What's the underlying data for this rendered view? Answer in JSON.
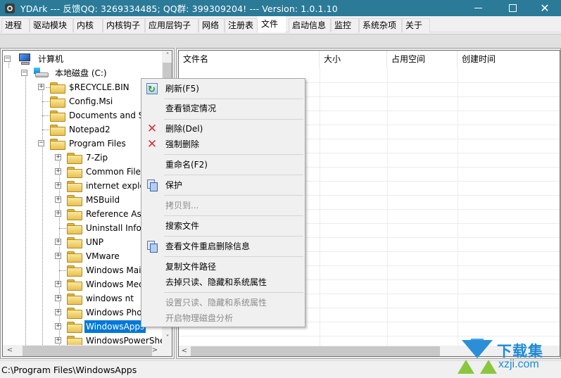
{
  "window": {
    "title": "YDArk --- 反馈QQ: 3269334485; QQ群: 399309204! --- Version: 1.0.1.10",
    "minimize_icon": "minimize-icon",
    "maximize_icon": "maximize-icon",
    "close_glyph": "✕"
  },
  "tabs": [
    {
      "label": "进程",
      "active": false
    },
    {
      "label": "驱动模块",
      "active": false
    },
    {
      "label": "内核",
      "active": false
    },
    {
      "label": "内核钩子",
      "active": false
    },
    {
      "label": "应用层钩子",
      "active": false
    },
    {
      "label": "网络",
      "active": false
    },
    {
      "label": "注册表",
      "active": false
    },
    {
      "label": "文件",
      "active": true
    },
    {
      "label": "启动信息",
      "active": false
    },
    {
      "label": "监控",
      "active": false
    },
    {
      "label": "系统杂项",
      "active": false
    },
    {
      "label": "关于",
      "active": false
    }
  ],
  "tree": {
    "root": {
      "label": "计算机",
      "expander": "−",
      "icon": "computer-icon"
    },
    "drive": {
      "label": "本地磁盘 (C:)",
      "expander": "−",
      "icon": "drive-icon"
    },
    "level1": [
      {
        "label": "$RECYCLE.BIN",
        "expander": "+"
      },
      {
        "label": "Config.Msi",
        "expander": ""
      },
      {
        "label": "Documents and Settings",
        "expander": ""
      },
      {
        "label": "Notepad2",
        "expander": ""
      },
      {
        "label": "Program Files",
        "expander": "−"
      }
    ],
    "level2": [
      {
        "label": "7-Zip",
        "expander": "+"
      },
      {
        "label": "Common Files",
        "expander": "+"
      },
      {
        "label": "internet explorer",
        "expander": "+"
      },
      {
        "label": "MSBuild",
        "expander": "+"
      },
      {
        "label": "Reference Assemblies",
        "expander": "+"
      },
      {
        "label": "Uninstall Information",
        "expander": ""
      },
      {
        "label": "UNP",
        "expander": "+"
      },
      {
        "label": "VMware",
        "expander": "+"
      },
      {
        "label": "Windows Mail",
        "expander": ""
      },
      {
        "label": "Windows Media Player",
        "expander": "+"
      },
      {
        "label": "windows nt",
        "expander": "+"
      },
      {
        "label": "Windows Photo Viewer",
        "expander": "+"
      },
      {
        "label": "WindowsApps",
        "expander": "+",
        "selected": true
      },
      {
        "label": "WindowsPowerShell",
        "expander": "+"
      }
    ],
    "scroll_up": "˄",
    "scroll_down": "˅",
    "scroll_left": "<",
    "scroll_right": ">"
  },
  "file_list": {
    "columns": [
      "文件名",
      "大小",
      "占用空间",
      "创建时间"
    ],
    "rows": [],
    "scroll_left": "<"
  },
  "context_menu": {
    "items": [
      {
        "label": "刷新(F5)",
        "icon": "refresh-icon",
        "disabled": false
      },
      {
        "label": "查看锁定情况",
        "icon": "",
        "disabled": false
      },
      {
        "label": "删除(Del)",
        "icon": "delete-icon",
        "disabled": false
      },
      {
        "label": "强制删除",
        "icon": "force-delete-icon",
        "disabled": false
      },
      {
        "label": "重命名(F2)",
        "icon": "",
        "disabled": false
      },
      {
        "label": "保护",
        "icon": "protect-icon",
        "disabled": false
      },
      {
        "label": "拷贝到...",
        "icon": "",
        "disabled": true
      },
      {
        "label": "搜索文件",
        "icon": "",
        "disabled": false
      },
      {
        "label": "查看文件重启删除信息",
        "icon": "reboot-delete-info-icon",
        "disabled": false
      },
      {
        "label": "复制文件路径",
        "icon": "",
        "disabled": false
      },
      {
        "label": "去掉只读、隐藏和系统属性",
        "icon": "",
        "disabled": false
      },
      {
        "label": "设置只读、隐藏和系统属性",
        "icon": "",
        "disabled": true
      },
      {
        "label": "开启物理磁盘分析",
        "icon": "",
        "disabled": true
      }
    ],
    "x_glyph": "✕"
  },
  "status_bar": {
    "path": "C:\\Program Files\\WindowsApps"
  },
  "watermark": {
    "cn": "下载集",
    "en": "xzji.com"
  },
  "colors": {
    "titlebar": "#2b7a98",
    "selection": "#0078d7",
    "delete_icon": "#d9303a"
  }
}
